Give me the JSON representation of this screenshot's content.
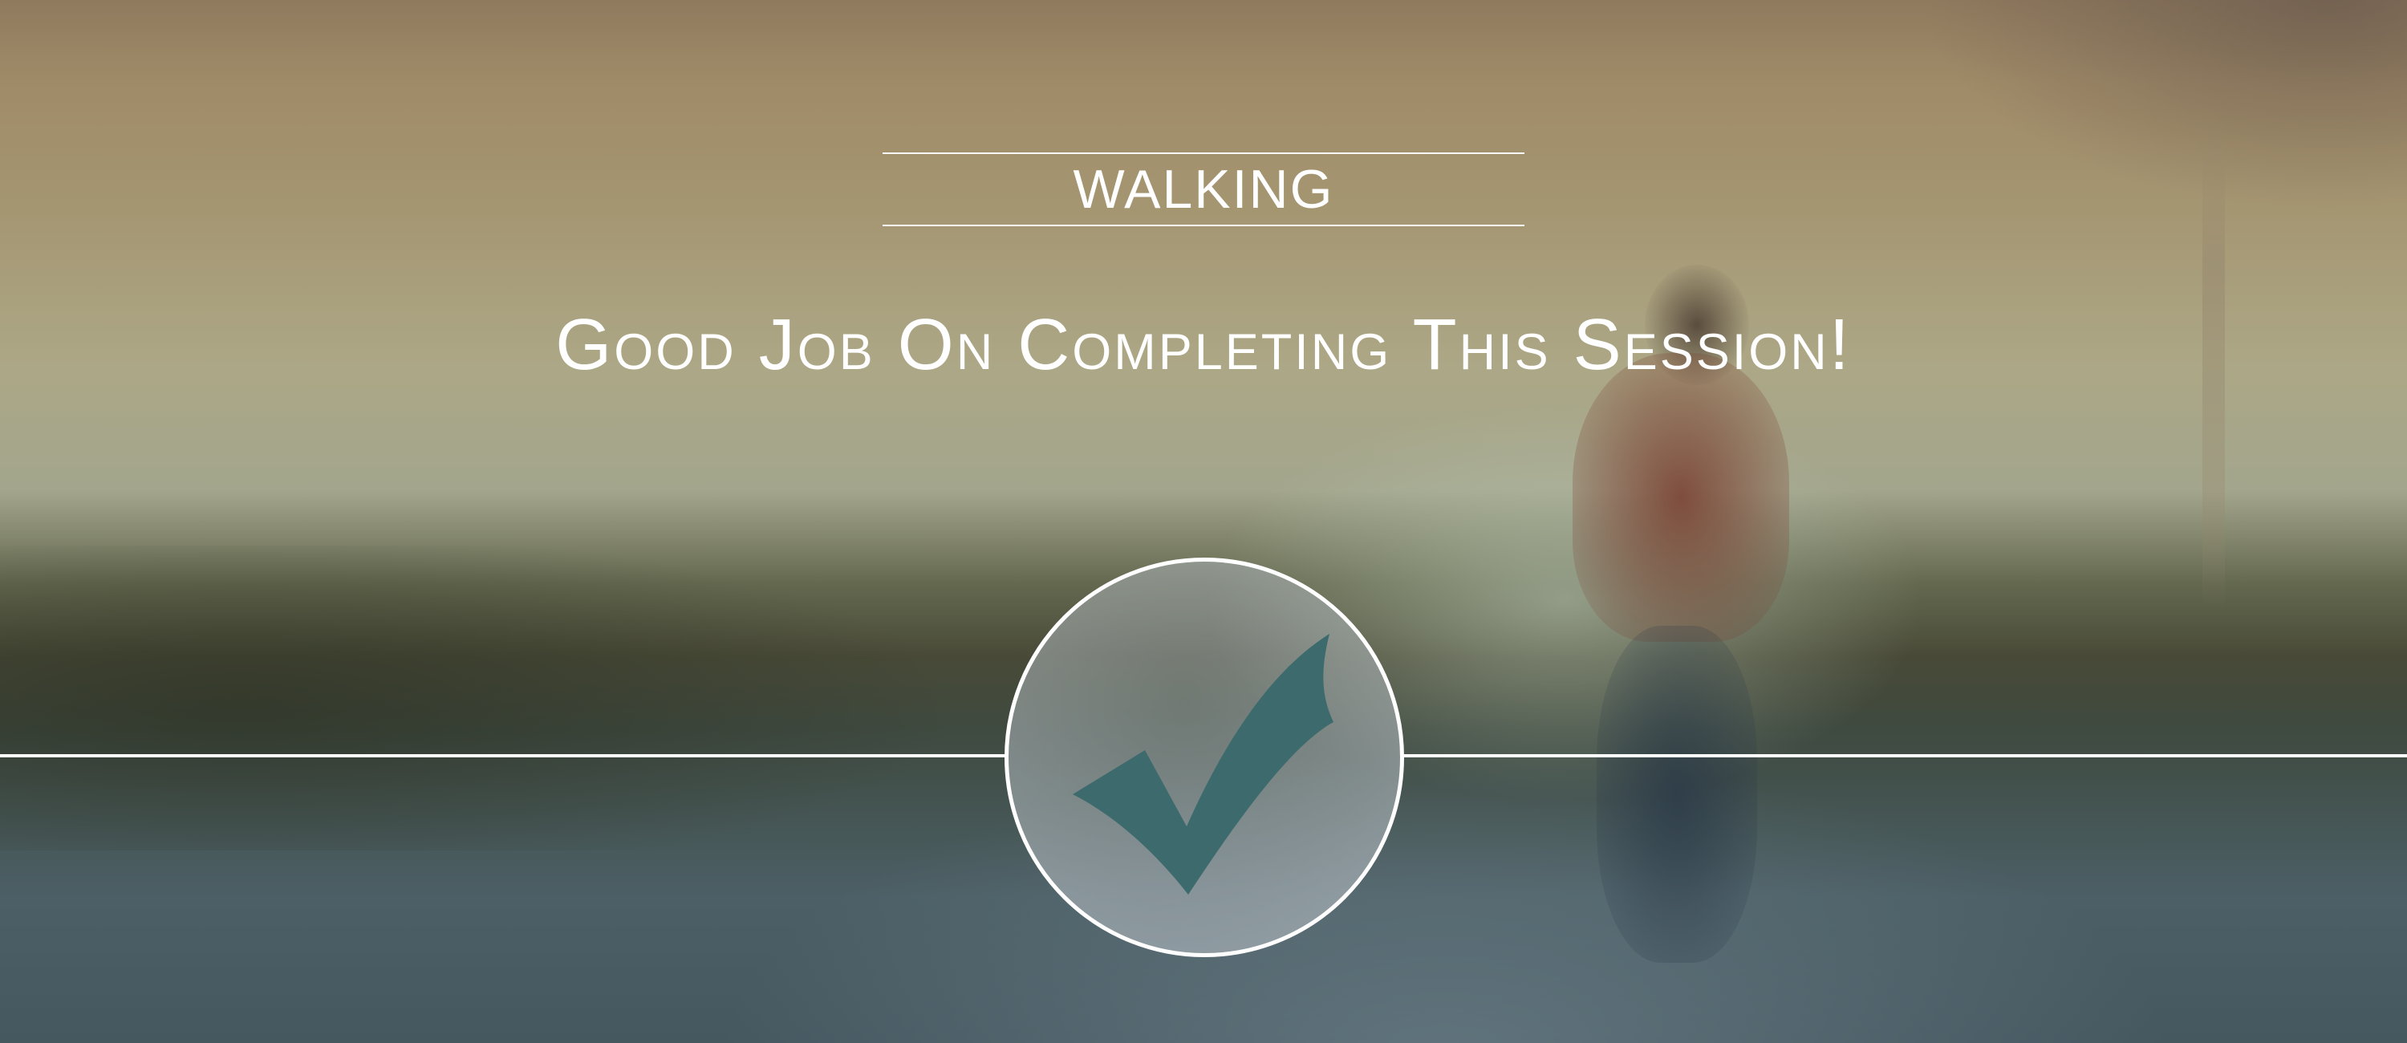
{
  "session": {
    "category": "WALKING",
    "headline": "Good Job On Completing This Session!"
  },
  "icons": {
    "status": "checkmark-icon"
  },
  "colors": {
    "text": "#ffffff",
    "rules": "#ffffff",
    "checkmark": "#3d6b6d",
    "circle_border": "#ffffff"
  }
}
